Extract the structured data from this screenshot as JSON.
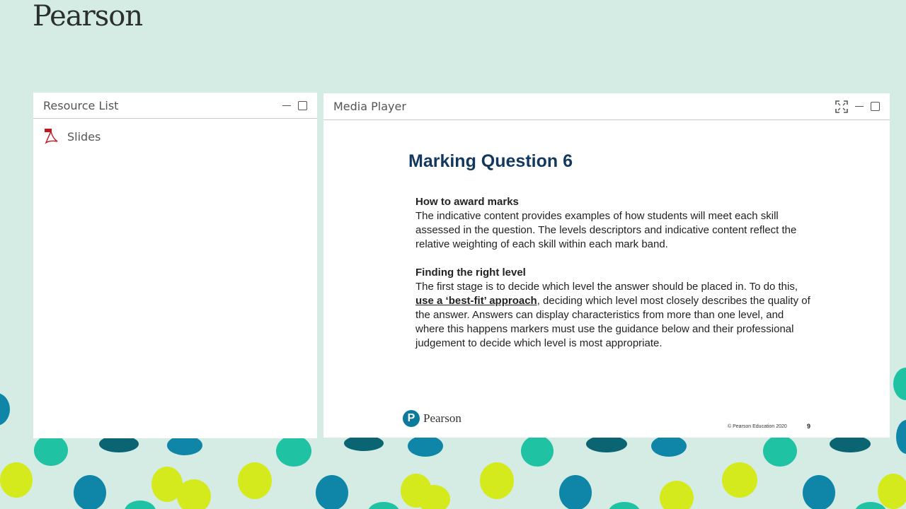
{
  "brand": {
    "logo_text": "Pearson"
  },
  "resource_list": {
    "title": "Resource List",
    "items": [
      {
        "label": "Slides",
        "icon": "pdf-icon"
      }
    ]
  },
  "media_player": {
    "title": "Media Player",
    "slide": {
      "title": "Marking Question 6",
      "section1_heading": "How to award marks",
      "section1_text": "The indicative content provides examples of how students will meet each skill assessed in the question. The levels descriptors and indicative content reflect the relative weighting of each skill within each mark band.",
      "section2_heading": "Finding the right level",
      "section2_text_a": "The first stage is to decide which level the answer should be placed in. To do this, ",
      "section2_link": "use a ‘best-fit’ approach",
      "section2_text_b": ", deciding which level most closely describes the quality of the answer. Answers can display characteristics from more than one level, and where this happens markers must use the guidance below and their professional judgement to decide which level is most appropriate.",
      "logo_mark": "P",
      "logo_text": "Pearson",
      "copyright": "© Pearson Education 2020",
      "page_number": "9"
    }
  },
  "colors": {
    "background": "#d4ece4",
    "title_blue": "#12395d",
    "dot_teal": "#1fc2a3",
    "dot_blue": "#0f86a8",
    "dot_lime": "#d4ea1c"
  }
}
